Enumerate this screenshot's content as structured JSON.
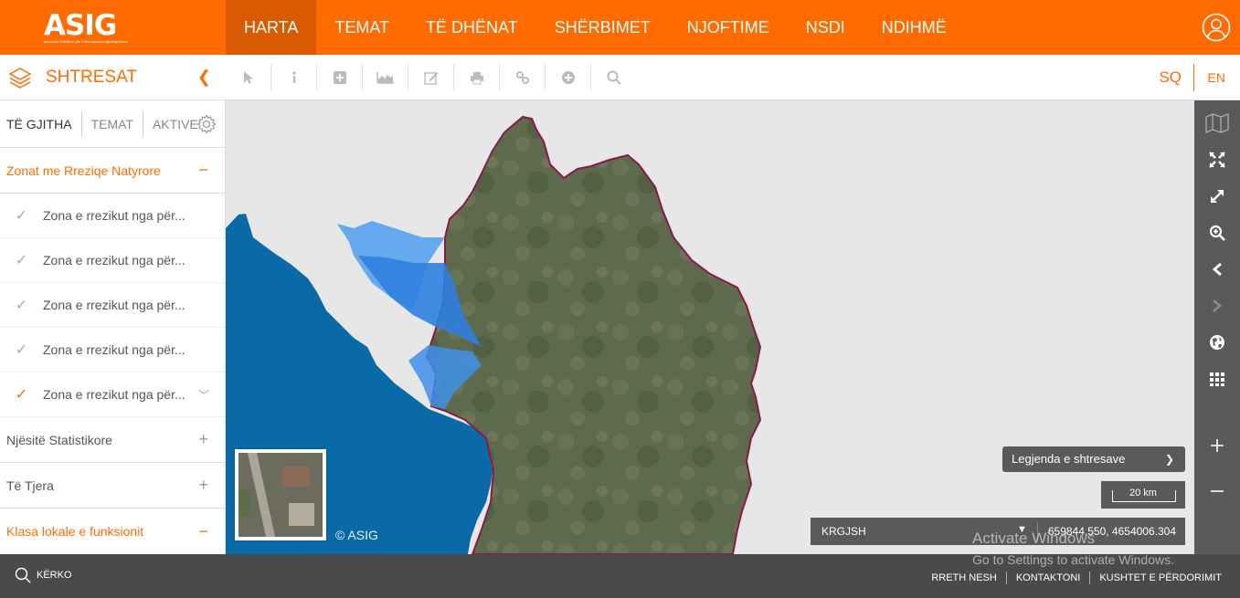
{
  "brand": {
    "logo": "ASIG",
    "tagline": "Autoriteti Shtetëror për Informacionin Gjeohapësinor"
  },
  "nav": [
    {
      "label": "HARTA",
      "active": true
    },
    {
      "label": "TEMAT"
    },
    {
      "label": "TË DHËNAT"
    },
    {
      "label": "SHËRBIMET"
    },
    {
      "label": "NJOFTIME"
    },
    {
      "label": "NSDI"
    },
    {
      "label": "NDIHMË"
    }
  ],
  "panel": {
    "title": "SHTRESAT"
  },
  "tools": [
    "pointer-icon",
    "info-icon",
    "add-box-icon",
    "chart-icon",
    "edit-icon",
    "print-icon",
    "link-icon",
    "plus-circle-icon",
    "search-icon"
  ],
  "lang": {
    "sq": "SQ",
    "en": "EN"
  },
  "tabs": {
    "all": "TË GJITHA",
    "themes": "TEMAT",
    "active": "AKTIVE"
  },
  "groups": {
    "hazards": "Zonat me Rreziqe Natyrore",
    "stats": "Njësitë Statistikore",
    "others": "Të Tjera",
    "local": "Klasa lokale e funksionit"
  },
  "layers": [
    {
      "label": "Zona e rrezikut nga për...",
      "checked": false
    },
    {
      "label": "Zona e rrezikut nga për...",
      "checked": false
    },
    {
      "label": "Zona e rrezikut nga për...",
      "checked": false
    },
    {
      "label": "Zona e rrezikut nga për...",
      "checked": false
    },
    {
      "label": "Zona e rrezikut nga për...",
      "checked": true
    }
  ],
  "map": {
    "copyright": "© ASIG",
    "legend": "Legjenda e shtresave",
    "scale": "20 km",
    "crs": "KRGJSH",
    "coords": "659844.550, 4654006.304"
  },
  "footer": {
    "search": "KËRKO",
    "about": "RRETH NESH",
    "contact": "KONTAKTONI",
    "terms": "KUSHTET E PËRDORIMIT"
  },
  "watermark": {
    "line1": "Activate Windows",
    "line2": "Go to Settings to activate Windows."
  },
  "colors": {
    "accent": "#ff6b00",
    "sea": "#0a6aa8",
    "flood": "#3d8fe6"
  }
}
